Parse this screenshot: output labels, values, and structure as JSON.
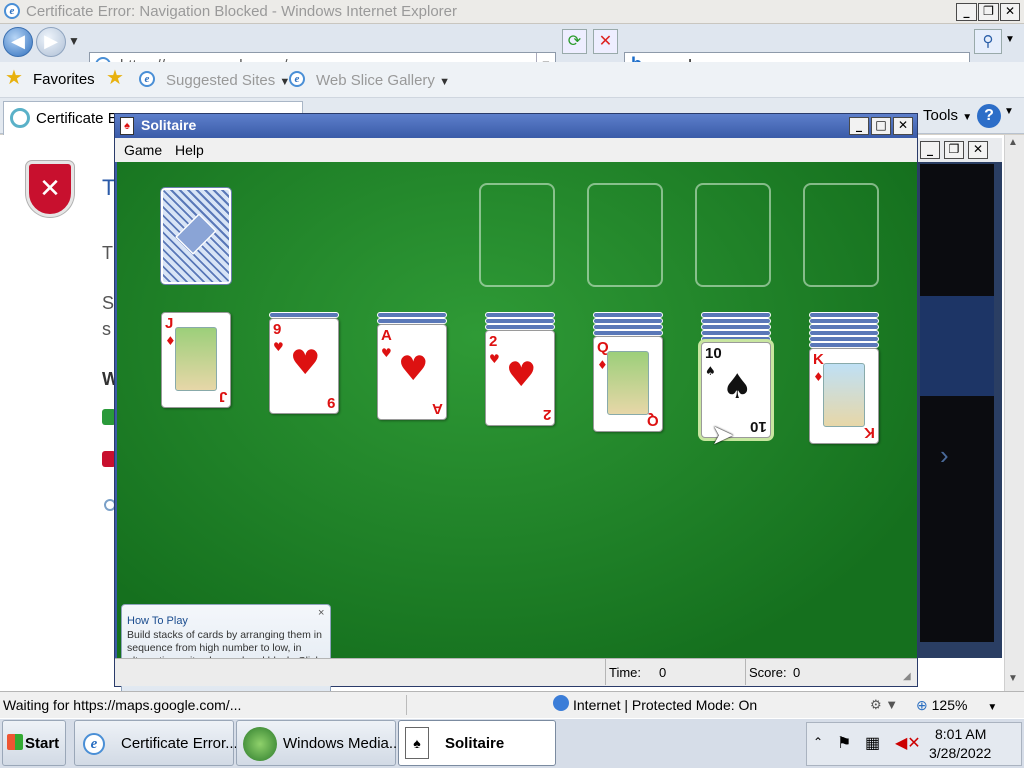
{
  "ie": {
    "title": "Certificate Error: Navigation Blocked - Windows Internet Explorer",
    "address": "https://maps.google.com/",
    "search_query": "google maps",
    "favorites_label": "Favorites",
    "suggested_sites": "Suggested Sites",
    "web_slice_gallery": "Web Slice Gallery",
    "tab_label": "Certificate Er",
    "tools_label": "Tools",
    "page_fragments": [
      "T",
      "T",
      "S",
      "s",
      "W"
    ],
    "status_text": "Waiting for https://maps.google.com/...",
    "zone_text": "Internet | Protected Mode: On",
    "zoom": "125%"
  },
  "solitaire": {
    "title": "Solitaire",
    "menu": [
      "Game",
      "Help"
    ],
    "time_label": "Time:",
    "time_value": "0",
    "score_label": "Score:",
    "score_value": "0",
    "tip": {
      "title": "How To Play",
      "body": "Build stacks of cards by arranging them in sequence from high number to low, in alternating suit colors red and black. Click and drag a card to move it.",
      "close": "×"
    },
    "tableau": [
      {
        "rank": "J",
        "suit": "♦",
        "color": "red",
        "hidden": 0,
        "face": true
      },
      {
        "rank": "9",
        "suit": "♥",
        "color": "red",
        "hidden": 1
      },
      {
        "rank": "A",
        "suit": "♥",
        "color": "red",
        "hidden": 2
      },
      {
        "rank": "2",
        "suit": "♥",
        "color": "red",
        "hidden": 3
      },
      {
        "rank": "Q",
        "suit": "♦",
        "color": "red",
        "hidden": 4,
        "face": true
      },
      {
        "rank": "10",
        "suit": "♠",
        "color": "black",
        "hidden": 5,
        "selected": true
      },
      {
        "rank": "K",
        "suit": "♦",
        "color": "red",
        "hidden": 6,
        "face": true
      }
    ]
  },
  "taskbar": {
    "start": "Start",
    "items": [
      "Certificate Error...",
      "Windows Media...",
      "Solitaire"
    ],
    "time": "8:01 AM",
    "date": "3/28/2022"
  },
  "colors": {
    "felt": "#1e8a2a",
    "card_back": "#5a78b8",
    "red_suit": "#dd1111",
    "title_bar": "#3a5ba8"
  }
}
